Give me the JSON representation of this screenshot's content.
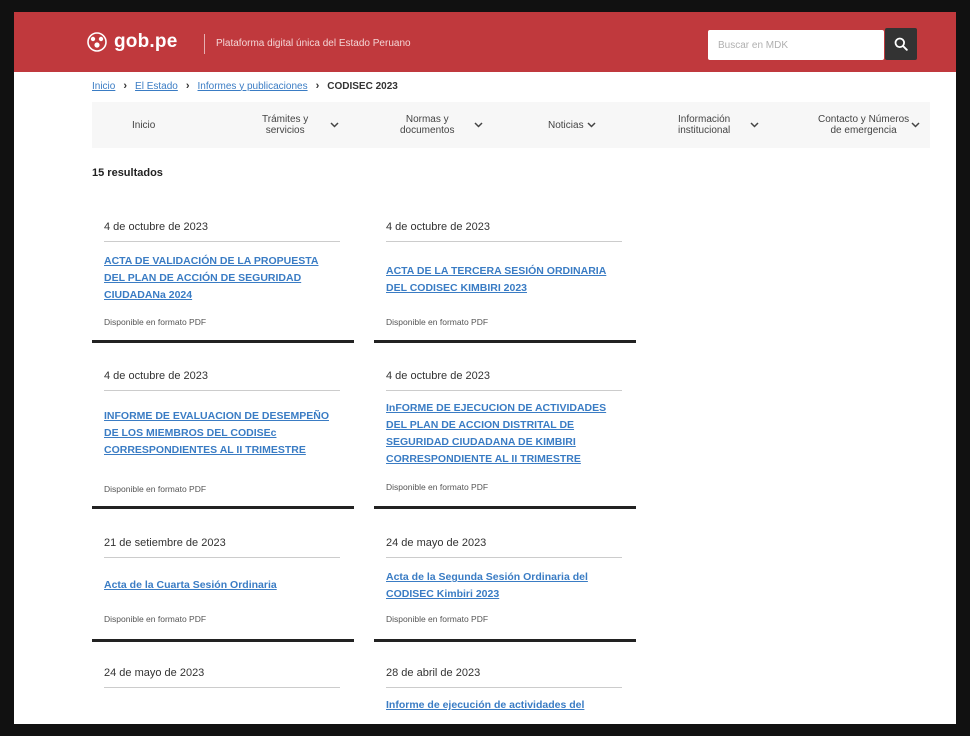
{
  "header": {
    "logo_text": "gob.pe",
    "tagline": "Plataforma digital única del Estado Peruano",
    "search_placeholder": "Buscar en MDK",
    "brand_color": "#c0393d"
  },
  "breadcrumb": {
    "items": [
      "Inicio",
      "El Estado",
      "Informes y publicaciones"
    ],
    "current": "CODISEC 2023"
  },
  "nav": {
    "items": [
      {
        "line1": "Inicio",
        "line2": ""
      },
      {
        "line1": "Trámites y",
        "line2": "servicios"
      },
      {
        "line1": "Normas y",
        "line2": "documentos"
      },
      {
        "line1": "Noticias",
        "line2": ""
      },
      {
        "line1": "Información",
        "line2": "institucional"
      },
      {
        "line1": "Contacto y Números",
        "line2": "de emergencia"
      }
    ]
  },
  "results": {
    "count_label": "15 resultados"
  },
  "cards": [
    {
      "date": "4 de octubre de 2023",
      "title": "ACTA DE VALIDACIÓN DE LA PROPUESTA DEL PLAN DE ACCIÓN DE SEGURIDAD CIUDADANa 2024",
      "meta": "Disponible en formato PDF"
    },
    {
      "date": "4 de octubre de 2023",
      "title": "ACTA DE LA TERCERA SESIÓN ORDINARIA DEL CODISEC KIMBIRI 2023",
      "meta": "Disponible en formato PDF"
    },
    {
      "date": "4 de octubre de 2023",
      "title": "INFORME DE EVALUACION DE DESEMPEÑO DE LOS MIEMBROS DEL CODISEc CORRESPONDIENTES AL II TRIMESTRE",
      "meta": "Disponible en formato PDF"
    },
    {
      "date": "4 de octubre de 2023",
      "title": "InFORME DE EJECUCION DE ACTIVIDADES DEL PLAN DE ACCION DISTRITAL DE SEGURIDAD CIUDADANA DE KIMBIRI CORRESPONDIENTE AL II TRIMESTRE",
      "meta": "Disponible en formato PDF"
    },
    {
      "date": "21 de setiembre de 2023",
      "title": "Acta de la Cuarta Sesión Ordinaria",
      "meta": "Disponible en formato PDF"
    },
    {
      "date": "24 de mayo de 2023",
      "title": "Acta de la Segunda Sesión Ordinaria del CODISEC Kimbiri 2023",
      "meta": "Disponible en formato PDF"
    },
    {
      "date": "24 de mayo de 2023",
      "title": "",
      "meta": ""
    },
    {
      "date": "28 de abril de 2023",
      "title": "Informe de ejecución de actividades del",
      "meta": ""
    }
  ]
}
